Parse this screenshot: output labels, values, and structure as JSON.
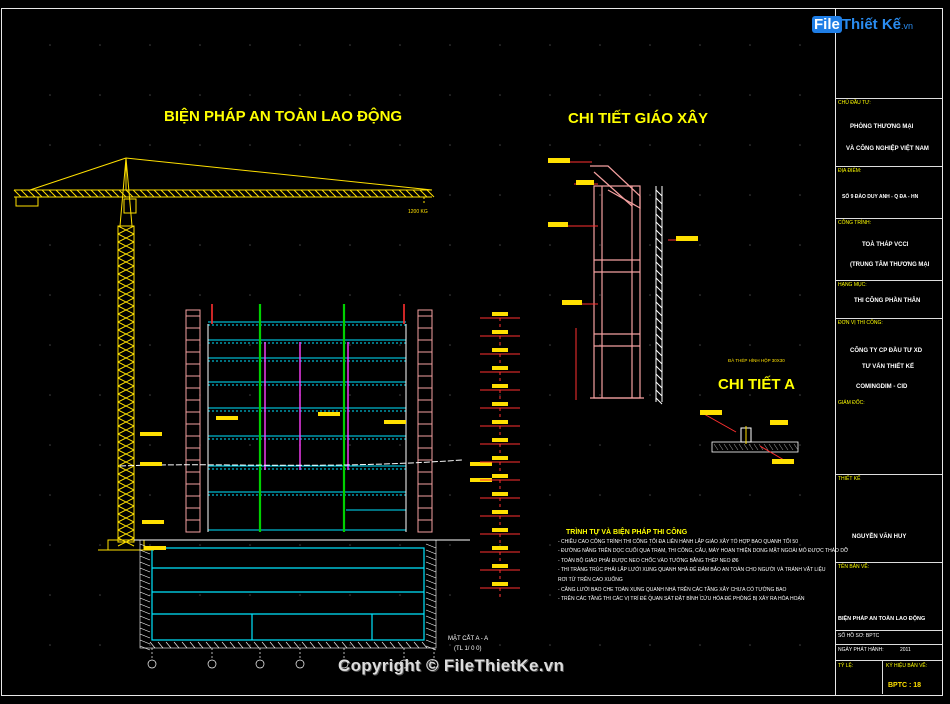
{
  "titles": {
    "safety": "BIỆN PHÁP AN TOÀN LAO ĐỘNG",
    "scaffold": "CHI TIẾT GIÁO XÂY",
    "detail_a": "CHI TIẾT A",
    "section": "MẶT CẮT A - A",
    "section_scale": "(TL 1/ 0 0)",
    "crane_load": "1200 KG",
    "scaffold_note": "ĐÀ THÉP HÌNH HỘP 30X30"
  },
  "notes": {
    "heading": "TRÌNH TỰ VÀ BIỆN PHÁP THI CÔNG",
    "lines": [
      "- CHIỀU CAO CÔNG TRÌNH THI CÔNG TỐI ĐA LIÊN HÀNH LẮP GIÁO XÂY TỔ HỢP BAO QUANH TỐI 50",
      "- ĐƯỜNG NÂNG TRÊN DỌC CUỐI QUA TRẠM, THI CÔNG, CÂU, MÁY HOẠN THIỆN DONG MẶT NGOÀI MÔ ĐƯỢC THÁO DỠ",
      "- TOÀN BỘ GIÁO PHẢI ĐƯỢC NEO CHỐC VÀO TƯỜNG BẰNG THÉP NEO Ø6",
      "- THI TRÀNG TRÚC PHẢI LẮP LƯỚI XUNG QUANH NHÀ ĐỂ ĐẢM BẢO AN TOÀN CHO NGƯỜI VÀ TRÁNH VẬT LIỆU",
      "  RƠI TỪ TRÊN CAO XUỐNG",
      "- CĂNG LƯỚI BAO CHE TOÀN XUNG QUANH NHÀ TRÊN CÁC TẦNG XÂY CHƯA CÓ TƯỜNG BAO",
      "- TRÊN CÁC TẦNG THI CÁC VỊ TRÍ ĐỂ QUAN SÁT ĐẶT BÌNH CỨU HỎA ĐỂ PHÒNG BỊ XẢY RA HỎA HOẠN"
    ]
  },
  "title_block": {
    "owner_label": "CHỦ ĐẦU TƯ:",
    "owner_1": "PHÒNG THƯƠNG MẠI",
    "owner_2": "VÀ CÔNG NGHIỆP VIỆT NAM",
    "address_label": "ĐỊA ĐIỂM:",
    "address": "SỐ 9 ĐÀO DUY ANH - Q ĐA - HN",
    "project_label": "CÔNG TRÌNH:",
    "project_1": "TOÀ THÁP VCCI",
    "project_2": "(TRUNG TÂM THƯƠNG MẠI",
    "item_label": "HẠNG MỤC:",
    "item": "THI CÔNG PHẦN THÂN",
    "contractor_label": "ĐƠN VỊ THI CÔNG:",
    "contractor_1": "CÔNG TY CP ĐẦU TƯ XD",
    "contractor_2": "TƯ VẤN THIẾT KẾ",
    "contractor_3": "COMINGDIM - CID",
    "director_label": "GIÁM ĐỐC:",
    "designer_label": "THIẾT KẾ",
    "designer": "NGUYỄN VĂN HUY",
    "drawing_label": "TÊN BẢN VẼ:",
    "drawing_name": "BIỆN PHÁP AN TOÀN LAO ĐỘNG",
    "sheet_no_label": "SỐ HỒ SƠ: BPTC",
    "date_label": "NGÀY PHÁT HÀNH:",
    "date": "2011",
    "scale_label": "TỶ LỆ:",
    "symbol_label": "KÝ HIỆU BẢN VẼ:",
    "symbol": "BPTC : 18"
  },
  "logo": {
    "part1": "File",
    "part2": "Thiết Kế",
    "suffix": ".vn"
  },
  "copyright": "Copyright © FileThietKe.vn",
  "colors": {
    "crane": "#ffe000",
    "scaffold": "#f4a0a0",
    "slab": "#00e5ff",
    "column": "#00d000",
    "tag": "#ffe000",
    "dim": "#ff3030",
    "basement": "#00e5ff",
    "brace": "#ff40ff"
  }
}
